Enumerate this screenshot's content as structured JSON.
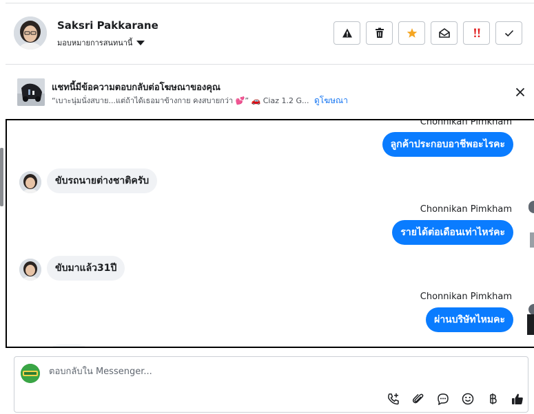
{
  "header": {
    "contact_name": "Saksri Pakkarane",
    "assign_label": "มอบหมายการสนทนานี้",
    "actions": [
      {
        "icon": "warning-icon"
      },
      {
        "icon": "trash-icon"
      },
      {
        "icon": "star-icon",
        "color": "#f5a623"
      },
      {
        "icon": "mark-unread-icon"
      },
      {
        "icon": "important-icon",
        "color": "#e02020"
      },
      {
        "icon": "check-icon"
      }
    ]
  },
  "ad_banner": {
    "title": "แชทนี้มีข้อความตอบกลับต่อโฆษณาของคุณ",
    "text": "“เบาะนุ่มนั่งสบาย...แต่ถ้าได้เธอมาข้างกาย คงสบายกว่า 💕” 🚗 Ciaz 1.2 G...",
    "link": "ดูโฆษณา"
  },
  "messages": [
    {
      "direction": "out",
      "sender": "Chonnikan Pimkham",
      "text": "ลูกค้าประกอบอาชีพอะไรคะ"
    },
    {
      "direction": "in",
      "text": "ขับรถนายต่างชาติครับ"
    },
    {
      "direction": "out",
      "sender": "Chonnikan Pimkham",
      "text": "รายได้ต่อเดือนเท่าไหร่คะ"
    },
    {
      "direction": "in",
      "text": "ขับมาแล้ว31ปี"
    },
    {
      "direction": "out",
      "sender": "Chonnikan Pimkham",
      "text": "ผ่านบริษัทไหมคะ"
    }
  ],
  "composer": {
    "placeholder": "ตอบกลับใน Messenger..."
  },
  "colors": {
    "accent": "#0a7cff",
    "link": "#1877f2"
  }
}
